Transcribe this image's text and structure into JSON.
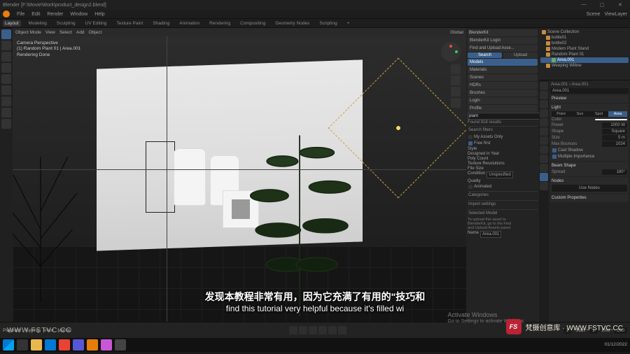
{
  "window": {
    "title": "Blender [F:\\Movie\\Work\\product_design2.blend]",
    "min": "—",
    "max": "▢",
    "close": "✕"
  },
  "topmenu": {
    "blender_icon": "blender",
    "items": [
      "File",
      "Edit",
      "Render",
      "Window",
      "Help"
    ],
    "right": {
      "scene_label": "Scene",
      "viewlayer_label": "ViewLayer"
    }
  },
  "workspaces": [
    "Layout",
    "Modeling",
    "Sculpting",
    "UV Editing",
    "Texture Paint",
    "Shading",
    "Animation",
    "Rendering",
    "Compositing",
    "Geometry Nodes",
    "Scripting",
    "+"
  ],
  "viewport_header": {
    "mode": "Object Mode",
    "menus": [
      "View",
      "Select",
      "Add",
      "Object"
    ],
    "orientation": "Global",
    "snap": "·"
  },
  "cam_overlay": {
    "line1": "Camera Perspective",
    "line2": "(1) Random Plant 01 | Area.001",
    "line3": "Rendering Done"
  },
  "blenderkit": {
    "header": "BlenderKit",
    "login": "BlenderKit Login",
    "findbtn": "Find and Upload Asse...",
    "tabs": [
      "Search",
      "Upload"
    ],
    "nav": [
      "Models",
      "Materials",
      "Scenes",
      "HDRs",
      "Brushes"
    ],
    "nav_active": "Models",
    "login2": "Login",
    "profile": "Profile",
    "search_label": "plant",
    "results": "Found 918 results",
    "filters_hdr": "Search filters",
    "my_assets": "My Assets Only",
    "free_first": "Free first",
    "style_lbl": "Style",
    "designed_lbl": "Designed in Year",
    "poly_lbl": "Poly Count",
    "texres_lbl": "Texture Resolutions",
    "filesize_lbl": "File Size",
    "condition_lbl": "Condition",
    "condition_val": "Unspecified",
    "quality_lbl": "Quality",
    "animated_lbl": "Animated",
    "categories": "Categories",
    "import_settings": "Import settings",
    "selected_model": "Selected Model",
    "upload_note1": "To upload this asset to",
    "upload_note2": "BlenderKit, go to the Find",
    "upload_note3": "and Upload Assets panel.",
    "selected_name_lbl": "Name",
    "selected_name": "Area.001"
  },
  "outliner": {
    "scene": "Scene Collection",
    "items": [
      {
        "label": "bottle01"
      },
      {
        "label": "bottle02"
      },
      {
        "label": "Modern Plant Stand"
      },
      {
        "label": "Random Plant 01",
        "children": [
          "Area.001"
        ]
      },
      {
        "label": "Weeping Willow"
      }
    ],
    "selected": "Area.001"
  },
  "properties": {
    "crumb1": "Area.001",
    "crumb2": "Area.001",
    "datablock": "Area.001",
    "light_panel": "Light",
    "preview": "Preview",
    "light_types": [
      "Point",
      "Sun",
      "Spot",
      "Area"
    ],
    "light_type_active": "Area",
    "color_lbl": "Color",
    "power_lbl": "Power",
    "power_val": "1000 W",
    "shape_lbl": "Shape",
    "shape_val": "Square",
    "size_lbl": "Size",
    "size_val": "5 m",
    "bounces_lbl": "Max Bounces",
    "bounces_val": "1024",
    "cast_shadow": "Cast Shadow",
    "multi_importance": "Multiple Importance",
    "beam_panel": "Beam Shape",
    "spread_lbl": "Spread",
    "spread_val": "180°",
    "nodes_panel": "Nodes",
    "use_nodes": "Use Nodes",
    "custom_panel": "Custom Properties"
  },
  "timeline": {
    "menus": [
      "Playback",
      "Keying",
      "View",
      "Marker"
    ],
    "cur_lbl": "",
    "cur": "1",
    "start_lbl": "Start",
    "start": "1",
    "end_lbl": "End",
    "end": "250"
  },
  "activate": {
    "l1": "Activate Windows",
    "l2": "Go to Settings to activate Windows."
  },
  "taskbar": {
    "date": "01/12/2022"
  },
  "subtitles": {
    "cn": "发现本教程非常有用，因为它充满了有用的\"技巧和",
    "en": "find this tutorial very helpful because it's filled wi"
  },
  "watermark_left": "WWW.FSTVC.CC",
  "watermark_right": {
    "badge": "FS",
    "text": "梵摄创意库 · WWW.FSTVC.CC"
  }
}
